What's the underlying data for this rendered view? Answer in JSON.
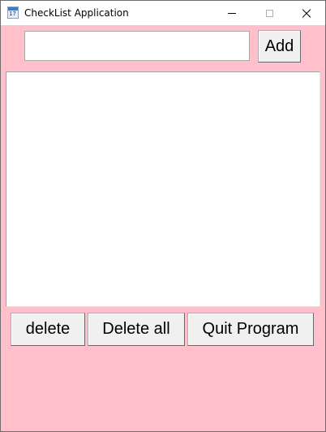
{
  "window": {
    "title": "CheckList Application",
    "app_icon": "calendar-icon",
    "app_icon_number": "17",
    "background_color": "#ffc0cb"
  },
  "controls": {
    "minimize_icon": "minimize-icon",
    "maximize_icon": "maximize-icon",
    "close_icon": "close-icon"
  },
  "task_entry": {
    "value": "",
    "placeholder": ""
  },
  "buttons": {
    "add": "Add",
    "delete": "delete",
    "delete_all": "Delete all",
    "quit": "Quit Program"
  },
  "task_list": {
    "items": []
  }
}
